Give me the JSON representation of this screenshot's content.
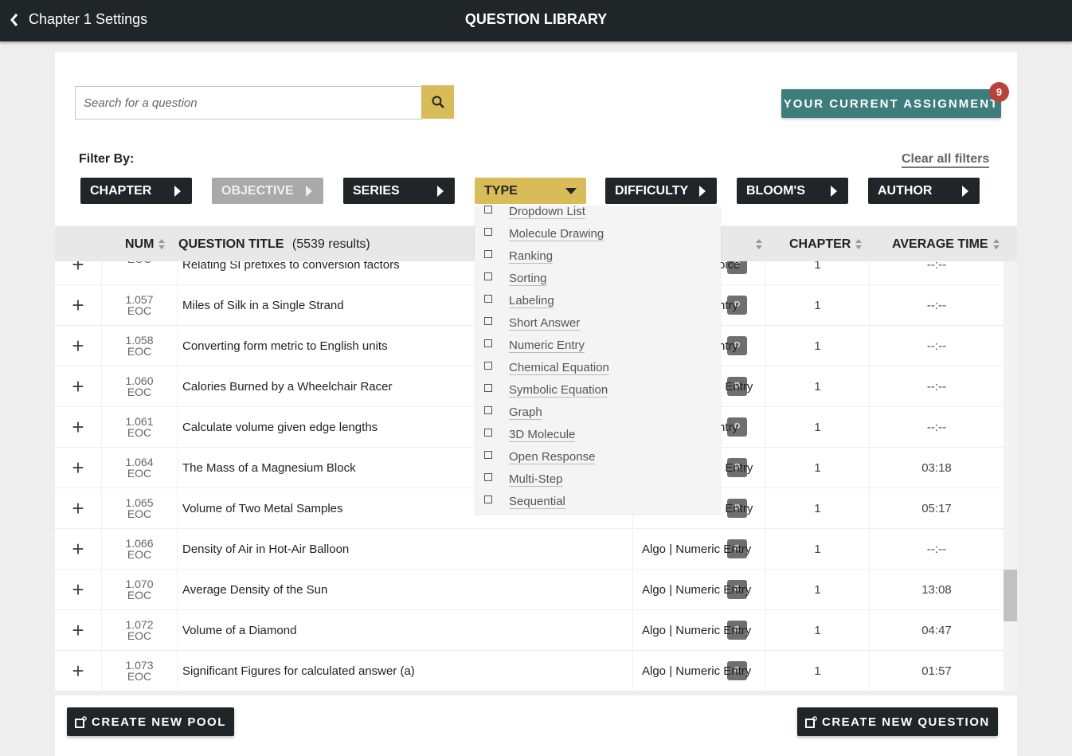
{
  "header": {
    "back_label": "Chapter 1 Settings",
    "title": "QUESTION LIBRARY"
  },
  "search": {
    "placeholder": "Search for a question"
  },
  "assignment": {
    "label": "YOUR CURRENT ASSIGNMENT",
    "count": "9"
  },
  "filters": {
    "label": "Filter By:",
    "clear_label": "Clear all filters",
    "buttons": [
      {
        "label": "CHAPTER",
        "state": "normal"
      },
      {
        "label": "OBJECTIVE",
        "state": "disabled"
      },
      {
        "label": "SERIES",
        "state": "normal"
      },
      {
        "label": "TYPE",
        "state": "open"
      },
      {
        "label": "DIFFICULTY",
        "state": "normal"
      },
      {
        "label": "BLOOM'S",
        "state": "normal"
      },
      {
        "label": "AUTHOR",
        "state": "normal"
      }
    ]
  },
  "type_dropdown": {
    "options": [
      "Dropdown List",
      "Molecule Drawing",
      "Ranking",
      "Sorting",
      "Labeling",
      "Short Answer",
      "Numeric Entry",
      "Chemical Equation",
      "Symbolic Equation",
      "Graph",
      "3D Molecule",
      "Open Response",
      "Multi-Step",
      "Sequential"
    ]
  },
  "table": {
    "columns": {
      "num": "NUM",
      "title": "QUESTION TITLE",
      "results": "(5539 results)",
      "chapter": "CHAPTER",
      "avg_time": "AVERAGE TIME"
    },
    "rows": [
      {
        "num": "",
        "src": "EOC",
        "title": "Relating SI prefixes to conversion factors",
        "type": "oice",
        "partial": true,
        "chapter": "1",
        "time": "--:--"
      },
      {
        "num": "1.057",
        "src": "EOC",
        "title": "Miles of Silk in a Single Strand",
        "type": "ntry",
        "partial": true,
        "chapter": "1",
        "time": "--:--"
      },
      {
        "num": "1.058",
        "src": "EOC",
        "title": "Converting form metric to English units",
        "type": "ntry",
        "partial": true,
        "chapter": "1",
        "time": "--:--"
      },
      {
        "num": "1.060",
        "src": "EOC",
        "title": "Calories Burned by a Wheelchair Racer",
        "type": ": Entry",
        "partial": true,
        "chapter": "1",
        "time": "--:--"
      },
      {
        "num": "1.061",
        "src": "EOC",
        "title": "Calculate volume given edge lengths",
        "type": "ntry",
        "partial": true,
        "chapter": "1",
        "time": "--:--"
      },
      {
        "num": "1.064",
        "src": "EOC",
        "title": "The Mass of a Magnesium Block",
        "type": ": Entry",
        "partial": true,
        "chapter": "1",
        "time": "03:18"
      },
      {
        "num": "1.065",
        "src": "EOC",
        "title": "Volume of Two Metal Samples",
        "type": ": Entry",
        "partial": true,
        "chapter": "1",
        "time": "05:17"
      },
      {
        "num": "1.066",
        "src": "EOC",
        "title": "Density of Air in Hot-Air Balloon",
        "type": "Algo | Numeric Entry",
        "partial": false,
        "chapter": "1",
        "time": "--:--"
      },
      {
        "num": "1.070",
        "src": "EOC",
        "title": "Average Density of the Sun",
        "type": "Algo | Numeric Entry",
        "partial": false,
        "chapter": "1",
        "time": "13:08"
      },
      {
        "num": "1.072",
        "src": "EOC",
        "title": "Volume of a Diamond",
        "type": "Algo | Numeric Entry",
        "partial": false,
        "chapter": "1",
        "time": "04:47"
      },
      {
        "num": "1.073",
        "src": "EOC",
        "title": "Significant Figures for calculated answer (a)",
        "type": "Algo | Numeric Entry",
        "partial": false,
        "chapter": "1",
        "time": "01:57"
      }
    ]
  },
  "footer": {
    "create_pool": "CREATE NEW POOL",
    "create_question": "CREATE NEW QUESTION"
  },
  "colors": {
    "topbar": "#202528",
    "accent_yellow": "#d9bb57",
    "teal": "#3d7d7c",
    "badge_red": "#b9423b"
  }
}
